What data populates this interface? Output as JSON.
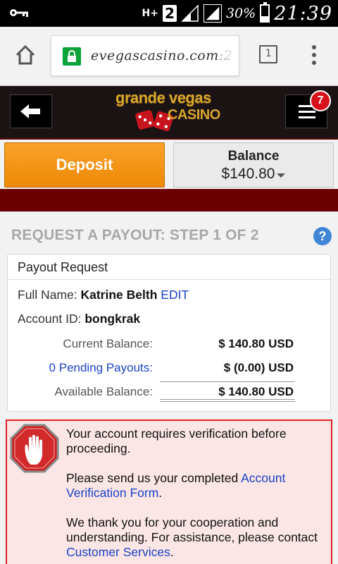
{
  "status_bar": {
    "network": "H+",
    "sim_slot": "2",
    "battery_percent": "30%",
    "time": "21:39",
    "icons": [
      "key-icon",
      "signal-icon",
      "signal-icon",
      "battery-icon"
    ]
  },
  "browser": {
    "url": "evegascasino.com",
    "url_overflow": ":2",
    "tab_count": "1",
    "icons": [
      "home-icon",
      "lock-icon",
      "overflow-menu-icon"
    ]
  },
  "site_header": {
    "logo_top": "grande vegas",
    "logo_bottom": "CASINO",
    "notification_count": "7",
    "icons": [
      "back-arrow-icon",
      "dice-icon",
      "hamburger-icon"
    ]
  },
  "account_bar": {
    "deposit_label": "Deposit",
    "balance_label": "Balance",
    "balance_value": "$140.80"
  },
  "page": {
    "title": "REQUEST A PAYOUT: STEP 1 OF 2",
    "help_label": "?"
  },
  "payout": {
    "panel_title": "Payout Request",
    "full_name_label": "Full Name:",
    "full_name_value": "Katrine Belth",
    "edit_label": "EDIT",
    "account_id_label": "Account ID:",
    "account_id_value": "bongkrak",
    "rows": [
      {
        "label": "Current Balance:",
        "value": "$ 140.80 USD"
      },
      {
        "label": "0 Pending Payouts:",
        "value": "$ (0.00) USD"
      },
      {
        "label": "Available Balance:",
        "value": "$ 140.80 USD"
      }
    ]
  },
  "alert": {
    "line1": "Your account requires verification before proceeding.",
    "line2_prefix": "Please send us your completed ",
    "line2_link": "Account Verification Form",
    "line2_suffix": ".",
    "line3_prefix": "We thank you for your cooperation and understanding. For assistance, please contact ",
    "line3_link": "Customer Services",
    "line3_suffix": ".",
    "colors": {
      "border": "#e02020",
      "background": "#fbe5e5",
      "link": "#1a43c8"
    }
  }
}
